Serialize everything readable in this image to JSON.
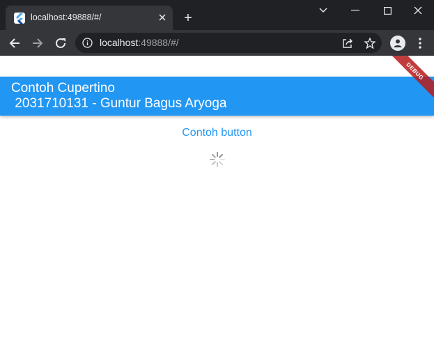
{
  "browser": {
    "tab_title": "localhost:49888/#/",
    "new_tab_symbol": "+",
    "url_host": "localhost",
    "url_rest": ":49888/#/",
    "accent": "#2196f3"
  },
  "app": {
    "title_line1": "Contoh Cupertino",
    "title_line2": " 2031710131 - Guntur Bagus Aryoga",
    "button_label": "Contoh button",
    "debug_label": "DEBUG",
    "appbar_color": "#2196f3"
  },
  "icons": {
    "favicon": "flutter-icon",
    "tab_close": "close-icon",
    "back": "back-arrow-icon",
    "forward": "forward-arrow-icon",
    "reload": "reload-icon",
    "info": "info-icon",
    "share": "share-icon",
    "bookmark": "star-icon",
    "profile": "profile-icon",
    "menu": "kebab-menu-icon",
    "spinner": "activity-indicator-icon"
  }
}
